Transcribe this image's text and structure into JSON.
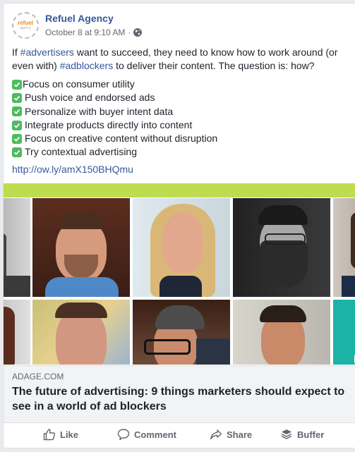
{
  "post": {
    "page_name": "Refuel Agency",
    "logo": {
      "line1": "refuel",
      "line2": "agency"
    },
    "timestamp": "October 8 at 9:10 AM",
    "separator": "·",
    "privacy_icon": "globe-icon",
    "text": {
      "p1_pre": "If ",
      "hashtag1": "#advertisers",
      "p1_mid": " want to succeed, they need to know how to work around (or even with) ",
      "hashtag2": "#adblockers",
      "p1_post": " to deliver their content. The question is: how?"
    },
    "checklist_icon": "check-mark-button-icon",
    "checklist": [
      "Focus on consumer utility",
      "Push voice and endorsed ads",
      "Personalize with buyer intent data",
      "Integrate products directly into content",
      "Focus on creative content without disruption",
      "Try contextual advertising"
    ],
    "link": "http://ow.ly/amX150BHQmu"
  },
  "preview": {
    "domain": "ADAGE.COM",
    "headline": "The future of advertising: 9 things marketers should expect to see in a world of ad blockers",
    "accent_bar_color": "#bddc4f"
  },
  "actions": [
    {
      "label": "Like",
      "icon": "thumbs-up-icon"
    },
    {
      "label": "Comment",
      "icon": "comment-icon"
    },
    {
      "label": "Share",
      "icon": "share-icon"
    },
    {
      "label": "Buffer",
      "icon": "buffer-icon"
    }
  ]
}
